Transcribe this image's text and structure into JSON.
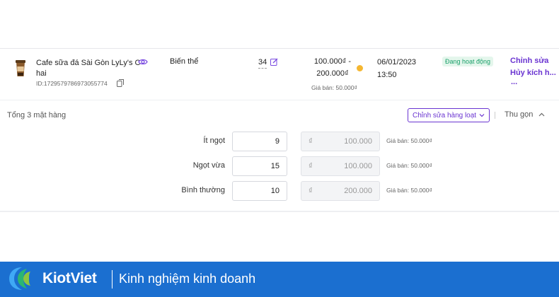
{
  "product": {
    "name_line1": "Cafe sữa đá Sài Gòn LyLy's C",
    "name_line2": "hai",
    "id": "ID:1729579786973055774",
    "variant_label": "Biến thể",
    "stock": "34",
    "price_range_line1": "100.000₫ -",
    "price_range_line2": "200.000₫",
    "sale_price": "Giá bán: 50.000₫",
    "date": "06/01/2023",
    "time": "13:50",
    "status": "Đang hoạt động",
    "actions": {
      "edit": "Chỉnh sửa",
      "cancel": "Hủy kích h...",
      "more": "..."
    }
  },
  "summary": {
    "total": "Tổng 3 mặt hàng",
    "bulk_edit": "Chỉnh sửa hàng loạt",
    "collapse": "Thu gọn"
  },
  "variants": [
    {
      "label": "Ít ngọt",
      "qty": "9",
      "currency": "₫",
      "price": "100.000",
      "sale": "Giá bán: 50.000₫"
    },
    {
      "label": "Ngọt vừa",
      "qty": "15",
      "currency": "₫",
      "price": "100.000",
      "sale": "Giá bán: 50.000₫"
    },
    {
      "label": "Bình thường",
      "qty": "10",
      "currency": "₫",
      "price": "200.000",
      "sale": "Giá bán: 50.000₫"
    }
  ],
  "banner": {
    "brand": "KiotViet",
    "tagline": "Kinh nghiệm kinh doanh"
  },
  "colors": {
    "accent": "#6a34d1",
    "status_green": "#1aa06a",
    "banner_blue": "#1b6fd0",
    "warning": "#f5b731"
  },
  "icons": [
    "coffee-cup-icon",
    "eye-icon",
    "copy-icon",
    "edit-icon",
    "info-dot-icon",
    "chevron-down-icon",
    "chevron-up-icon",
    "kiotviet-logo"
  ]
}
